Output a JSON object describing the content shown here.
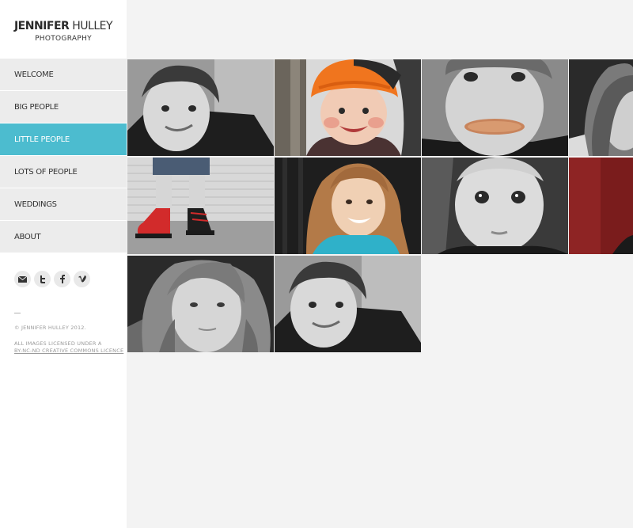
{
  "site": {
    "logo_first": "JENNIFER",
    "logo_last": "HULLEY",
    "logo_sub": "PHOTOGRAPHY"
  },
  "nav": {
    "items": [
      {
        "label": "WELCOME"
      },
      {
        "label": "BIG PEOPLE"
      },
      {
        "label": "LITTLE PEOPLE"
      },
      {
        "label": "LOTS OF PEOPLE"
      },
      {
        "label": "WEDDINGS"
      },
      {
        "label": "ABOUT"
      }
    ],
    "active": "LITTLE PEOPLE",
    "active_color": "#4cbccf"
  },
  "social": [
    {
      "icon": "mail-icon"
    },
    {
      "icon": "twitter-icon"
    },
    {
      "icon": "facebook-icon"
    },
    {
      "icon": "vimeo-icon"
    }
  ],
  "footer": {
    "copyright": "© JENNIFER HULLEY 2012.",
    "license_line1": "ALL IMAGES LICENSED UNDER A",
    "license_link": "BY-NC-ND CREATIVE COMMONS LICENCE"
  },
  "gallery": {
    "photos": [
      {
        "subject": "smiling boy, black and white"
      },
      {
        "subject": "child in orange knit hat, color"
      },
      {
        "subject": "boy with tongue out, black and white"
      },
      {
        "subject": "girl with long hair, partial"
      },
      {
        "subject": "legs in red sneakers, partial color"
      },
      {
        "subject": "smiling girl, color"
      },
      {
        "subject": "baby face, black and white"
      },
      {
        "subject": "red background portrait, partial"
      },
      {
        "subject": "girl with long hair, black and white"
      },
      {
        "subject": "smiling boy, black and white"
      }
    ]
  }
}
